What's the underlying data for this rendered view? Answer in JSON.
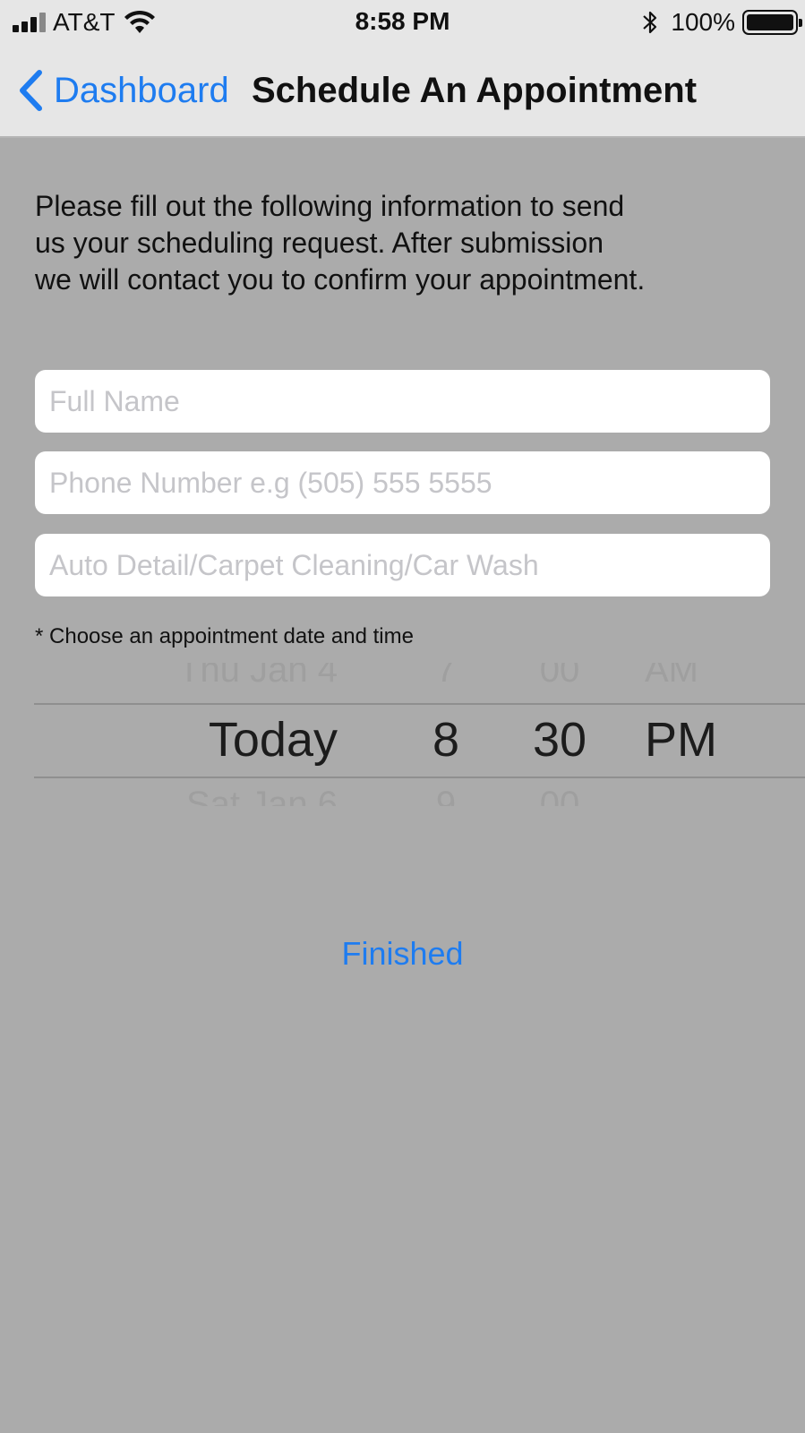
{
  "status_bar": {
    "carrier": "AT&T",
    "time": "8:58 PM",
    "battery": "100%"
  },
  "nav": {
    "back_label": "Dashboard",
    "title": "Schedule An Appointment"
  },
  "intro": {
    "line1": "Please fill out the following information to send",
    "line2": "us your scheduling request. After submission",
    "line3": "we will contact you to confirm your appointment."
  },
  "form": {
    "full_name_placeholder": "Full Name",
    "phone_placeholder": "Phone Number e.g (505) 555 5555",
    "service_placeholder": "Auto Detail/Carpet Cleaning/Car Wash"
  },
  "picker": {
    "label": "* Choose an appointment date and time",
    "prev": {
      "date": "Thu Jan 4",
      "hour": "7",
      "minute": "00",
      "ampm": "AM"
    },
    "selected": {
      "date": "Today",
      "hour": "8",
      "minute": "30",
      "ampm": "PM"
    },
    "next": {
      "date": "Sat Jan 6",
      "hour": "9",
      "minute": "00",
      "ampm": ""
    }
  },
  "finished_label": "Finished",
  "colors": {
    "accent": "#1e7cf0",
    "background": "#ababab",
    "bar": "#e6e6e6"
  }
}
